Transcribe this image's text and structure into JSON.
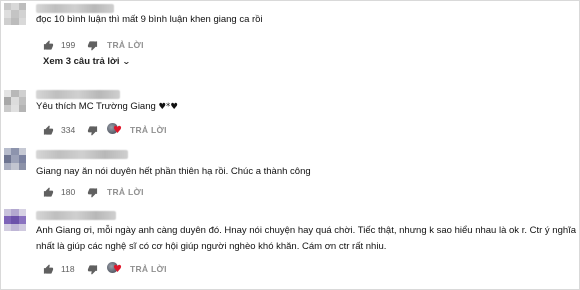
{
  "comments": [
    {
      "text": "đọc 10 bình luận thì mất 9 bình luận khen giang ca rồi",
      "likes": "199",
      "reply_label": "TRẢ LỜI",
      "has_creator_heart": false,
      "view_replies": "Xem 3 câu trả lời"
    },
    {
      "text": "Yêu thích MC Trường Giang ",
      "hearts": "♥*♥",
      "likes": "334",
      "reply_label": "TRẢ LỜI",
      "has_creator_heart": true
    },
    {
      "text": "Giang nay ăn nói duyên hết phần thiên hạ rồi. Chúc a thành công",
      "likes": "180",
      "reply_label": "TRẢ LỜI",
      "has_creator_heart": false
    },
    {
      "text_lines": [
        "Anh Giang ơi, mỗi ngày anh càng duyên đó. Hnay nói chuyện hay quá chời. Tiếc thật, nhưng k sao hiểu nhau là ok r. Ctr ý nghĩa",
        "nhất là giúp các nghệ sĩ có cơ hội giúp người nghèo khó khăn. Cám ơn ctr rất nhiu."
      ],
      "likes": "118",
      "reply_label": "TRẢ LỜI",
      "has_creator_heart": true
    }
  ],
  "colors": {
    "creator_heart": "#e0162b",
    "meta_text": "#606060",
    "reply_text": "#909090"
  },
  "icons": [
    "thumbs-up-icon",
    "thumbs-down-icon",
    "creator-heart-icon",
    "chevron-down-icon"
  ]
}
